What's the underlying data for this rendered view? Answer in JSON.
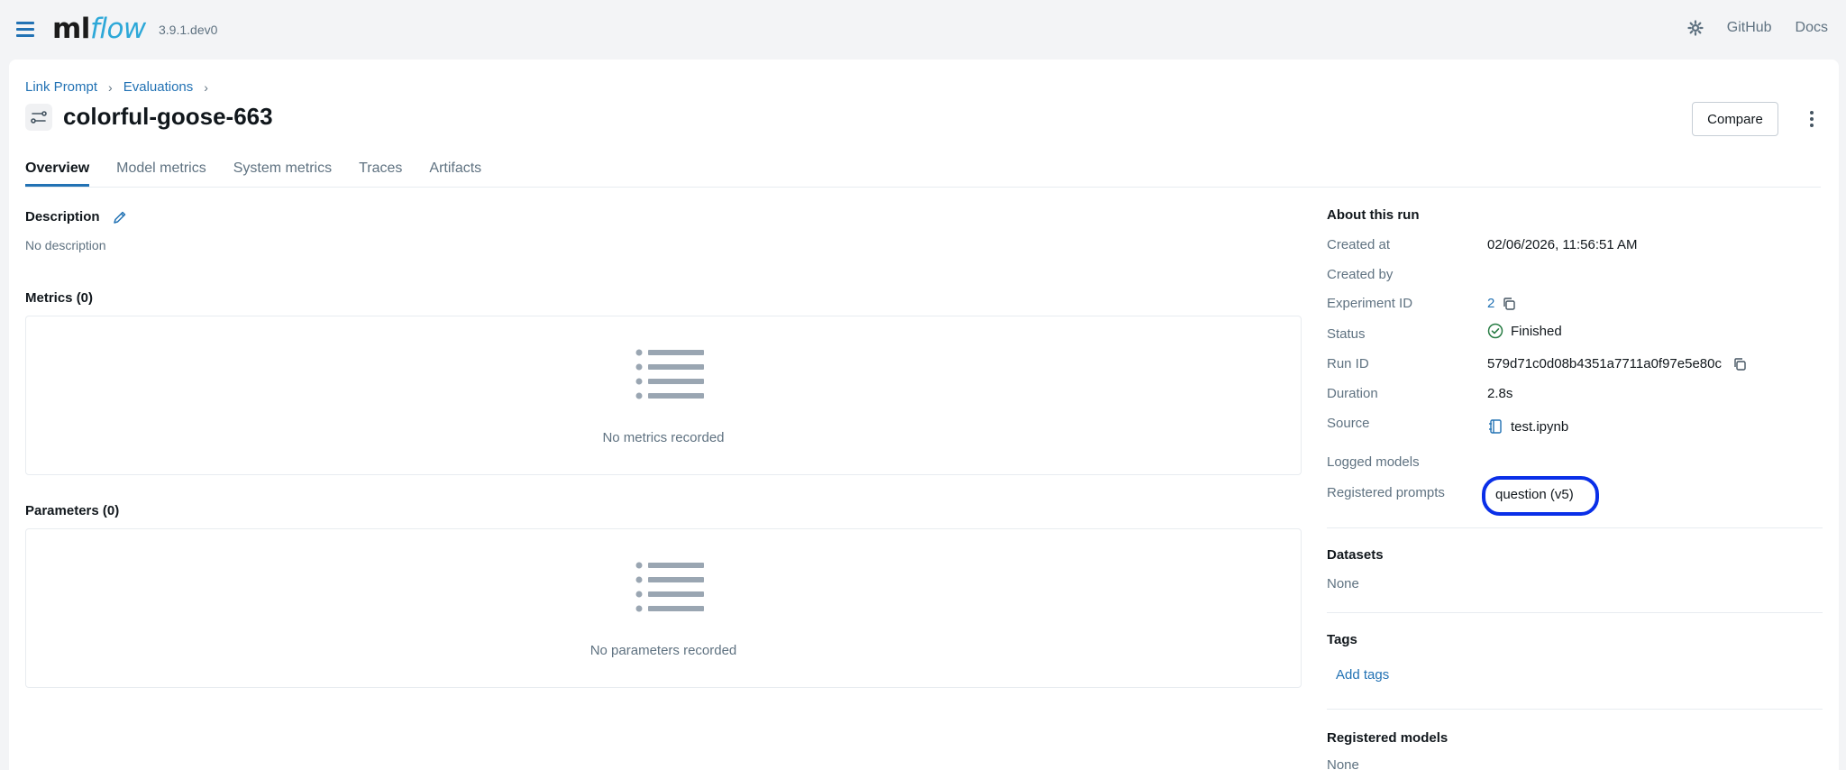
{
  "app": {
    "logo_ml": "ml",
    "logo_flow": "flow",
    "version": "3.9.1.dev0"
  },
  "topnav": {
    "github": "GitHub",
    "docs": "Docs"
  },
  "breadcrumb": {
    "items": [
      "Link Prompt",
      "Evaluations"
    ],
    "separator": "›"
  },
  "run": {
    "title": "colorful-goose-663"
  },
  "toolbar": {
    "compare_label": "Compare"
  },
  "tabs": [
    {
      "label": "Overview",
      "active": true
    },
    {
      "label": "Model metrics"
    },
    {
      "label": "System metrics"
    },
    {
      "label": "Traces"
    },
    {
      "label": "Artifacts"
    }
  ],
  "description": {
    "title": "Description",
    "text": "No description"
  },
  "metrics": {
    "title": "Metrics (0)",
    "empty_text": "No metrics recorded"
  },
  "parameters": {
    "title": "Parameters (0)",
    "empty_text": "No parameters recorded"
  },
  "about": {
    "title": "About this run",
    "created_at_label": "Created at",
    "created_at": "02/06/2026, 11:56:51 AM",
    "created_by_label": "Created by",
    "experiment_id_label": "Experiment ID",
    "experiment_id": "2",
    "status_label": "Status",
    "status": "Finished",
    "run_id_label": "Run ID",
    "run_id": "579d71c0d08b4351a7711a0f97e5e80c",
    "duration_label": "Duration",
    "duration": "2.8s",
    "source_label": "Source",
    "source": "test.ipynb",
    "logged_models_label": "Logged models",
    "registered_prompts_label": "Registered prompts",
    "registered_prompt": "question (v5)"
  },
  "datasets": {
    "title": "Datasets",
    "value": "None"
  },
  "tags": {
    "title": "Tags",
    "add_label": "Add tags"
  },
  "registered_models": {
    "title": "Registered models",
    "value": "None"
  },
  "colors": {
    "link": "#2272b4",
    "success": "#277c43",
    "highlight": "#0a2fe8"
  },
  "icons": [
    "hamburger-icon",
    "gear-icon",
    "run-icon",
    "pencil-icon",
    "list-icon",
    "copy-icon",
    "check-circle-icon",
    "notebook-icon",
    "kebab-icon"
  ]
}
